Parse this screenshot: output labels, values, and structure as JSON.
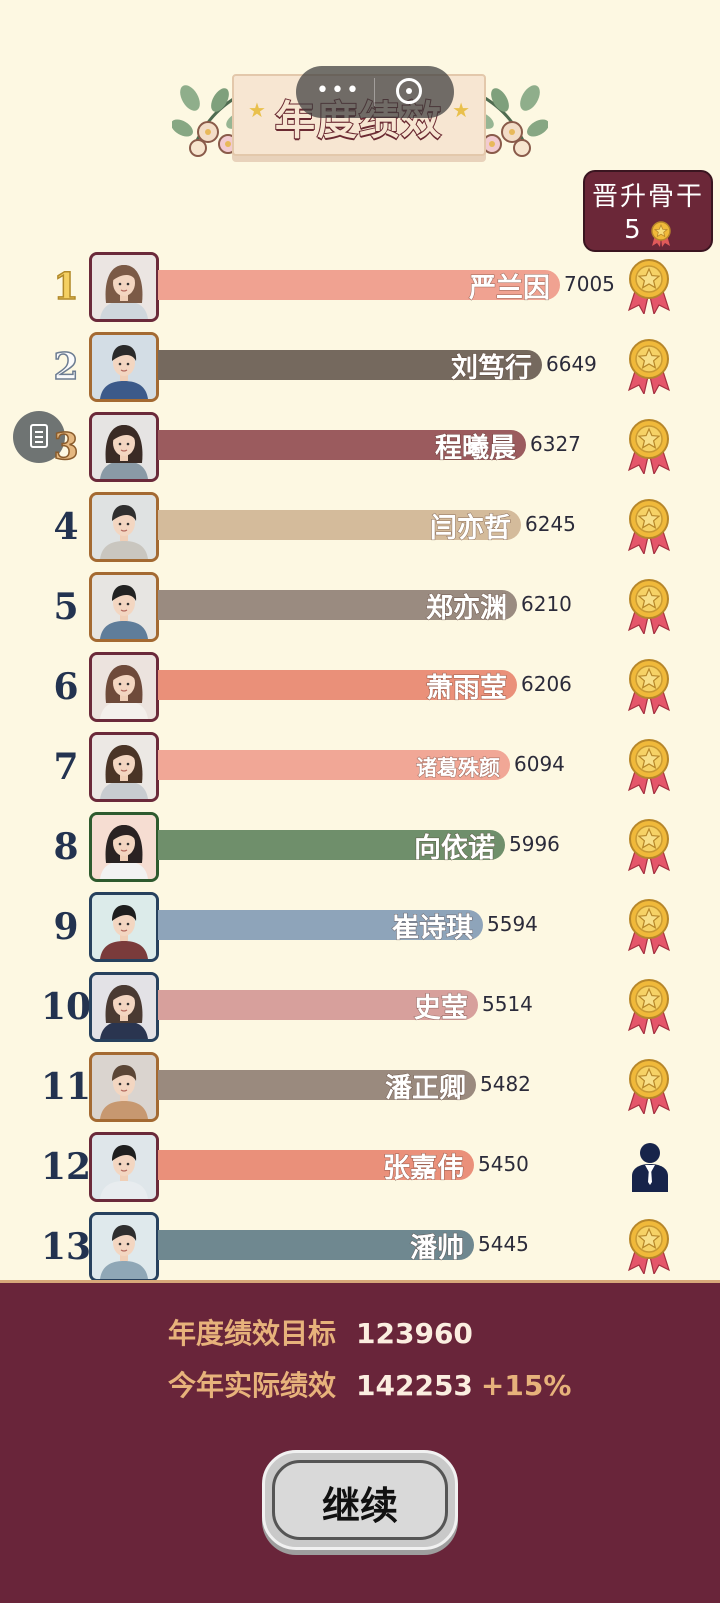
{
  "header": {
    "title": "年度绩效"
  },
  "promote_box": {
    "label": "晋升骨干",
    "count": "5",
    "icon": "medal-icon"
  },
  "float_button": {
    "icon": "document-icon"
  },
  "capsule": {
    "icons": [
      "more-dots-icon",
      "close-circle-icon"
    ]
  },
  "ranking": [
    {
      "rank": "1",
      "name": "严兰因",
      "score": "7005",
      "bar_color": "#f0a291",
      "avatar_bg": "#ebe5e2",
      "avatar_border": "#6b2a3a",
      "badge": "medal-icon"
    },
    {
      "rank": "2",
      "name": "刘笃行",
      "score": "6649",
      "bar_color": "#75695e",
      "avatar_bg": "#d3dde5",
      "avatar_border": "#a46a32",
      "badge": "medal-icon"
    },
    {
      "rank": "3",
      "name": "程曦晨",
      "score": "6327",
      "bar_color": "#9b5b5e",
      "avatar_bg": "#e6e4e3",
      "avatar_border": "#6b2a3a",
      "badge": "medal-icon"
    },
    {
      "rank": "4",
      "name": "闫亦哲",
      "score": "6245",
      "bar_color": "#d4bb9b",
      "avatar_bg": "#dfe2e2",
      "avatar_border": "#a46a32",
      "badge": "medal-icon"
    },
    {
      "rank": "5",
      "name": "郑亦渊",
      "score": "6210",
      "bar_color": "#9a8b80",
      "avatar_bg": "#e7e5e2",
      "avatar_border": "#a46a32",
      "badge": "medal-icon"
    },
    {
      "rank": "6",
      "name": "萧雨莹",
      "score": "6206",
      "bar_color": "#ea9079",
      "avatar_bg": "#ece3de",
      "avatar_border": "#6b2a3a",
      "badge": "medal-icon"
    },
    {
      "rank": "7",
      "name": "诸葛殊颜",
      "score": "6094",
      "bar_color": "#f1a796",
      "avatar_bg": "#ece8e4",
      "avatar_border": "#6b2a3a",
      "badge": "medal-icon"
    },
    {
      "rank": "8",
      "name": "向依诺",
      "score": "5996",
      "bar_color": "#6f8f6b",
      "avatar_bg": "#f6ddd2",
      "avatar_border": "#2e5a2e",
      "badge": "medal-icon"
    },
    {
      "rank": "9",
      "name": "崔诗琪",
      "score": "5594",
      "bar_color": "#8ea4ba",
      "avatar_bg": "#dcebea",
      "avatar_border": "#27415e",
      "badge": "medal-icon"
    },
    {
      "rank": "10",
      "name": "史莹",
      "score": "5514",
      "bar_color": "#d7a09c",
      "avatar_bg": "#e3e2e6",
      "avatar_border": "#27415e",
      "badge": "medal-icon"
    },
    {
      "rank": "11",
      "name": "潘正卿",
      "score": "5482",
      "bar_color": "#9a8a7e",
      "avatar_bg": "#dad4cf",
      "avatar_border": "#a46a32",
      "badge": "medal-icon"
    },
    {
      "rank": "12",
      "name": "张嘉伟",
      "score": "5450",
      "bar_color": "#ea907a",
      "avatar_bg": "#dfe6ea",
      "avatar_border": "#6b2a3a",
      "badge": "person-suit-icon"
    },
    {
      "rank": "13",
      "name": "潘帅",
      "score": "5445",
      "bar_color": "#6f8890",
      "avatar_bg": "#dfe9ec",
      "avatar_border": "#27415e",
      "badge": "medal-icon"
    }
  ],
  "footer": {
    "target_label": "年度绩效目标",
    "target_value": "123960",
    "actual_label": "今年实际绩效",
    "actual_value": "142253",
    "actual_change": "+15%"
  },
  "continue_button": {
    "label": "继续"
  }
}
